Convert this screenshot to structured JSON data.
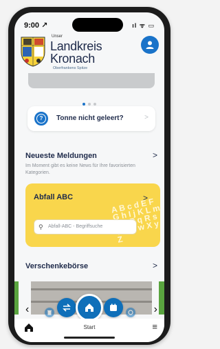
{
  "status_bar": {
    "time": "9:00 ↗",
    "icons": "ıl ᯤ ▭"
  },
  "header": {
    "brand_small": "Unser",
    "brand_line1": "Landkreis",
    "brand_line2": "Kronach",
    "brand_tagline": "Oberfrankens Spitze",
    "profile_icon": "user-icon",
    "accent_color": "#1a73c9"
  },
  "carousel": {
    "dots": 3,
    "active_dot": 1
  },
  "tonne_card": {
    "label": "Tonne nicht geleert?",
    "chevron": ">"
  },
  "news": {
    "title": "Neueste Meldungen",
    "chevron": ">",
    "empty_text": "Im Moment gibt es keine News für Ihre favorisierten Kategorien."
  },
  "abfall_abc": {
    "title": "Abfall ABC",
    "chevron": ">",
    "search_placeholder": "Abfall-ABC - Begriffsuche",
    "search_icon": "search-icon",
    "card_color": "#f9d64c"
  },
  "verschenke": {
    "title": "Verschenkebörse",
    "chevron": ">"
  },
  "bottom_nav": {
    "prev": "‹",
    "next": "›",
    "fabs": [
      "trash-icon",
      "swap-icon",
      "home-icon",
      "calendar-icon",
      "bin-icon"
    ]
  },
  "tabbar": {
    "start_label": "Start",
    "home_icon": "home-icon",
    "menu_icon": "menu-icon"
  }
}
